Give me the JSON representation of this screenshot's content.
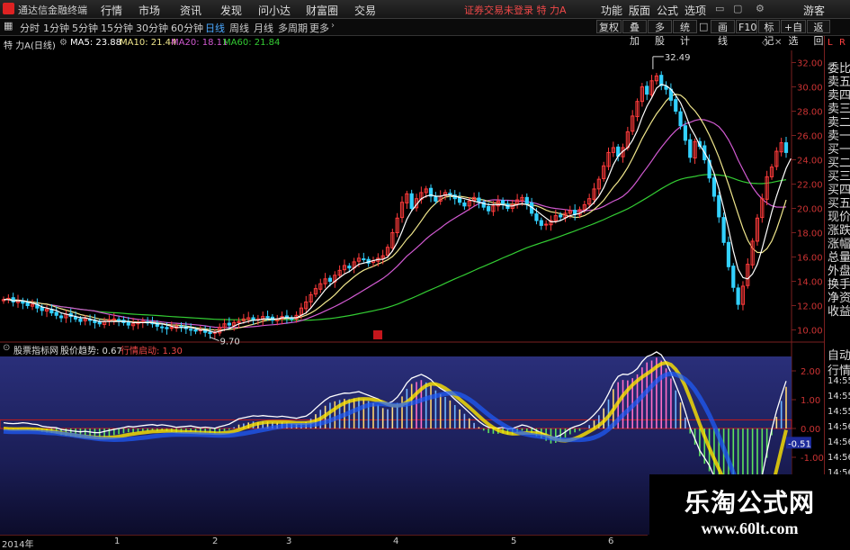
{
  "titlebar": {
    "app_name": "通达信金融终端",
    "menus": [
      "行情",
      "市场",
      "资讯",
      "发现",
      "问小达",
      "财富圈",
      "交易"
    ],
    "alert": "证券交易未登录  特 力A",
    "right_menus": [
      "功能",
      "版面",
      "公式",
      "选项"
    ],
    "guest": "游客"
  },
  "toolbar": {
    "periods": [
      "分时",
      "1分钟",
      "5分钟",
      "15分钟",
      "30分钟",
      "60分钟",
      "日线",
      "周线",
      "月线",
      "多周期",
      "更多"
    ],
    "active_period": "日线",
    "buttons": [
      "复权",
      "叠加",
      "多股",
      "统计",
      "画线",
      "F10",
      "标记",
      "+自选",
      "返回"
    ]
  },
  "ma_info": {
    "stock_label": "特 力A(日线)",
    "ma5": "MA5: 23.88",
    "ma10": "MA10: 21.44",
    "ma20": "MA20: 18.11",
    "ma60": "MA60: 21.84",
    "colors": {
      "ma5": "#ffffff",
      "ma10": "#f0e68c",
      "ma20": "#d25ad2",
      "ma60": "#33cc33"
    }
  },
  "price_axis": [
    "32.00",
    "30.00",
    "28.00",
    "26.00",
    "24.00",
    "22.00",
    "20.00",
    "18.00",
    "16.00",
    "14.00",
    "12.00",
    "10.00"
  ],
  "annotations": {
    "high": "32.49",
    "low": "9.70"
  },
  "right_panel": [
    "L",
    "R",
    "委比",
    "卖五",
    "卖四",
    "卖三",
    "卖二",
    "卖一",
    "买一",
    "买二",
    "买三",
    "买四",
    "买五",
    "现价",
    "涨跌",
    "涨幅",
    "总量",
    "外盘",
    "换手",
    "净资",
    "收益"
  ],
  "indicator": {
    "name": "股票指标网",
    "trend_label": "股价趋势: 0.67",
    "launch_label": "行情启动: 1.30",
    "axis": [
      "2.00",
      "1.00",
      "0.00",
      "-0.51",
      "-1.00"
    ],
    "right_labels": [
      "自动",
      "行情",
      "14:55",
      "14:55",
      "14:55",
      "14:56",
      "14:56",
      "14:56",
      "14:56",
      "14:56",
      "14:57"
    ]
  },
  "footer": {
    "months": [
      "2014年",
      "1",
      "2",
      "3",
      "4",
      "5",
      "6"
    ]
  },
  "watermark": {
    "title": "乐淘公式网",
    "url": "www.60lt.com"
  },
  "chart_data": {
    "type": "candlestick",
    "ylim": [
      9,
      33
    ],
    "close": [
      12.5,
      12.6,
      12.3,
      12.4,
      12.2,
      12.0,
      12.1,
      11.8,
      11.6,
      11.7,
      11.4,
      11.2,
      11.0,
      11.3,
      11.1,
      10.9,
      10.7,
      10.9,
      10.8,
      10.6,
      10.5,
      10.7,
      10.8,
      10.9,
      10.8,
      10.6,
      10.4,
      10.5,
      10.6,
      10.7,
      10.6,
      10.5,
      10.3,
      10.2,
      10.1,
      10.2,
      10.3,
      10.2,
      10.1,
      10.0,
      9.9,
      10.0,
      9.8,
      9.7,
      9.8,
      10.2,
      10.5,
      10.4,
      10.6,
      10.7,
      10.9,
      11.0,
      10.8,
      10.9,
      11.1,
      11.0,
      10.8,
      10.9,
      11.1,
      11.0,
      10.9,
      11.2,
      11.8,
      12.3,
      12.9,
      13.4,
      13.8,
      14.2,
      14.0,
      14.5,
      14.9,
      15.3,
      15.1,
      15.6,
      15.9,
      15.8,
      15.5,
      15.7,
      15.9,
      16.1,
      16.8,
      18.0,
      19.2,
      20.5,
      21.2,
      20.0,
      20.8,
      21.3,
      21.6,
      21.0,
      20.6,
      21.0,
      21.3,
      21.1,
      20.8,
      20.5,
      20.2,
      20.6,
      20.9,
      20.5,
      20.1,
      19.8,
      20.2,
      20.6,
      20.4,
      20.0,
      20.3,
      20.7,
      20.9,
      20.4,
      19.6,
      19.0,
      18.6,
      18.7,
      19.0,
      19.4,
      19.3,
      19.6,
      19.8,
      19.5,
      19.9,
      20.3,
      20.8,
      21.6,
      22.4,
      23.5,
      24.6,
      25.0,
      24.3,
      25.0,
      26.3,
      27.6,
      28.8,
      30.0,
      29.4,
      30.5,
      30.9,
      30.1,
      29.8,
      28.9,
      28.0,
      26.8,
      25.6,
      24.2,
      25.5,
      25.1,
      24.0,
      22.5,
      21.0,
      19.3,
      17.2,
      15.2,
      13.5,
      12.1,
      13.6,
      15.4,
      17.3,
      19.2,
      20.8,
      22.6,
      23.4,
      24.7,
      25.4,
      24.6
    ],
    "ma5": [
      12.5,
      12.5,
      12.4,
      12.4,
      12.4,
      12.3,
      12.2,
      12.1,
      11.9,
      11.8,
      11.7,
      11.6,
      11.4,
      11.3,
      11.2,
      11.1,
      11.0,
      11.0,
      10.9,
      10.8,
      10.7,
      10.7,
      10.7,
      10.7,
      10.7,
      10.7,
      10.7,
      10.6,
      10.6,
      10.6,
      10.6,
      10.6,
      10.5,
      10.5,
      10.4,
      10.3,
      10.2,
      10.2,
      10.2,
      10.2,
      10.1,
      10.0,
      10.0,
      9.9,
      9.8,
      9.9,
      10.0,
      10.1,
      10.3,
      10.5,
      10.6,
      10.7,
      10.8,
      10.8,
      10.9,
      10.9,
      10.9,
      10.9,
      11.0,
      11.0,
      11.0,
      11.0,
      11.2,
      11.4,
      11.8,
      12.3,
      12.8,
      13.3,
      13.7,
      14.0,
      14.3,
      14.6,
      14.8,
      15.1,
      15.4,
      15.5,
      15.6,
      15.7,
      15.8,
      15.8,
      16.0,
      16.5,
      17.2,
      18.1,
      19.1,
      19.8,
      20.3,
      20.8,
      21.0,
      21.1,
      21.0,
      21.0,
      21.1,
      21.1,
      21.0,
      20.9,
      20.8,
      20.7,
      20.6,
      20.5,
      20.4,
      20.3,
      20.3,
      20.3,
      20.3,
      20.2,
      20.2,
      20.3,
      20.4,
      20.3,
      20.1,
      19.8,
      19.5,
      19.2,
      18.9,
      18.9,
      19.0,
      19.2,
      19.4,
      19.5,
      19.6,
      19.8,
      20.1,
      20.5,
      21.0,
      21.7,
      22.6,
      23.6,
      24.3,
      24.7,
      25.0,
      25.6,
      26.4,
      27.5,
      28.4,
      29.1,
      29.9,
      30.2,
      30.1,
      29.8,
      29.3,
      28.7,
      27.8,
      26.7,
      26.0,
      25.2,
      24.6,
      23.9,
      22.9,
      21.6,
      20.0,
      18.3,
      16.5,
      15.0,
      14.3,
      14.2,
      14.6,
      15.4,
      16.7,
      18.2,
      19.7,
      21.0,
      22.2,
      23.3,
      24.1
    ]
  }
}
